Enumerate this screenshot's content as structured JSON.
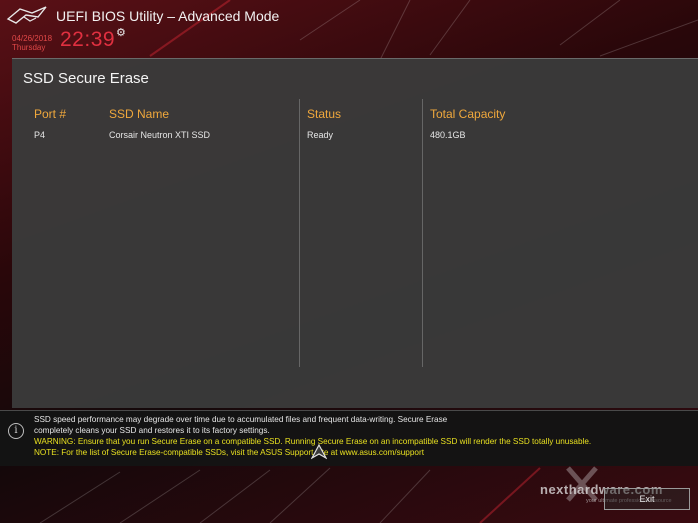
{
  "header": {
    "title": "UEFI BIOS Utility – Advanced Mode",
    "date": "04/26/2018",
    "weekday": "Thursday",
    "time": "22:39"
  },
  "panel": {
    "title": "SSD Secure Erase",
    "columns": [
      "Port #",
      "SSD Name",
      "Status",
      "Total Capacity"
    ],
    "rows": [
      {
        "port": "P4",
        "name": "Corsair Neutron XTI SSD",
        "status": "Ready",
        "capacity": "480.1GB"
      }
    ]
  },
  "info": {
    "line1": "SSD speed performance may degrade over time due to accumulated files and frequent data-writing. Secure Erase",
    "line2": "completely cleans your SSD and restores it to its factory settings.",
    "line3": "WARNING: Ensure that you run Secure Erase on a compatible SSD. Running Secure Erase on an incompatible SSD will render the SSD totally unusable.",
    "line4": "NOTE: For the list of Secure Erase-compatible SSDs, visit the ASUS Support site at www.asus.com/support"
  },
  "footer": {
    "exit_label": "Exit",
    "watermark": "nexthardware.com",
    "watermark_sub": "your ultimate professional resource"
  },
  "colors": {
    "accent_red": "#e03040",
    "column_header": "#f0a83c",
    "warning_yellow": "#e8e020"
  },
  "icons": [
    "rog-logo-icon",
    "gear-icon",
    "info-icon",
    "mouse-cursor-icon"
  ]
}
